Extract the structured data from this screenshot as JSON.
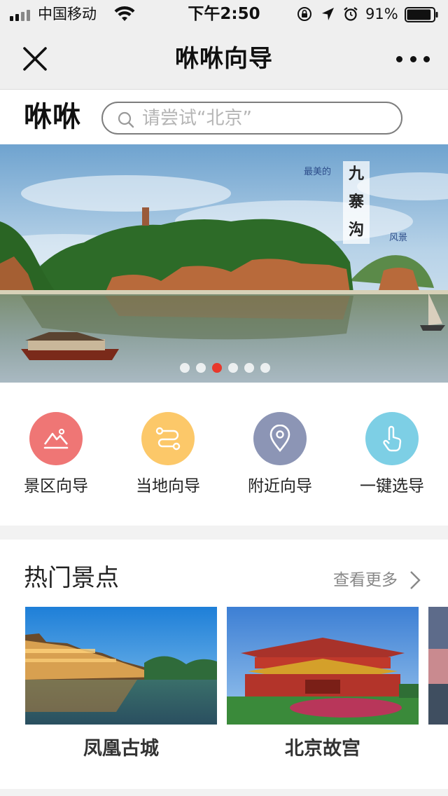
{
  "status_bar": {
    "carrier": "中国移动",
    "time": "下午2:50",
    "battery_percent": "91%",
    "battery_level": 0.91,
    "icons": [
      "signal-icon",
      "wifi-icon",
      "orientation-lock-icon",
      "location-arrow-icon",
      "alarm-icon",
      "battery-icon"
    ]
  },
  "nav": {
    "title": "咻咻向导",
    "close_icon": "close-icon",
    "more_icon": "more-icon"
  },
  "search": {
    "logo": "咻咻",
    "placeholder": "请尝试“北京”"
  },
  "banner": {
    "caption_small_left": "最美的",
    "caption_vertical": [
      "九",
      "寨",
      "沟"
    ],
    "caption_small_right": "风景",
    "slide_count": 6,
    "active_slide": 3
  },
  "quick_nav": [
    {
      "label": "景区向导",
      "icon": "mountain-icon",
      "color": "#ef7675"
    },
    {
      "label": "当地向导",
      "icon": "route-icon",
      "color": "#fcc869"
    },
    {
      "label": "附近向导",
      "icon": "location-pin-icon",
      "color": "#8c95b5"
    },
    {
      "label": "一键选导",
      "icon": "hand-tap-icon",
      "color": "#7dcfe5"
    }
  ],
  "hot_spots": {
    "title": "热门景点",
    "more_label": "查看更多",
    "items": [
      {
        "name": "凤凰古城"
      },
      {
        "name": "北京故宫"
      }
    ]
  }
}
